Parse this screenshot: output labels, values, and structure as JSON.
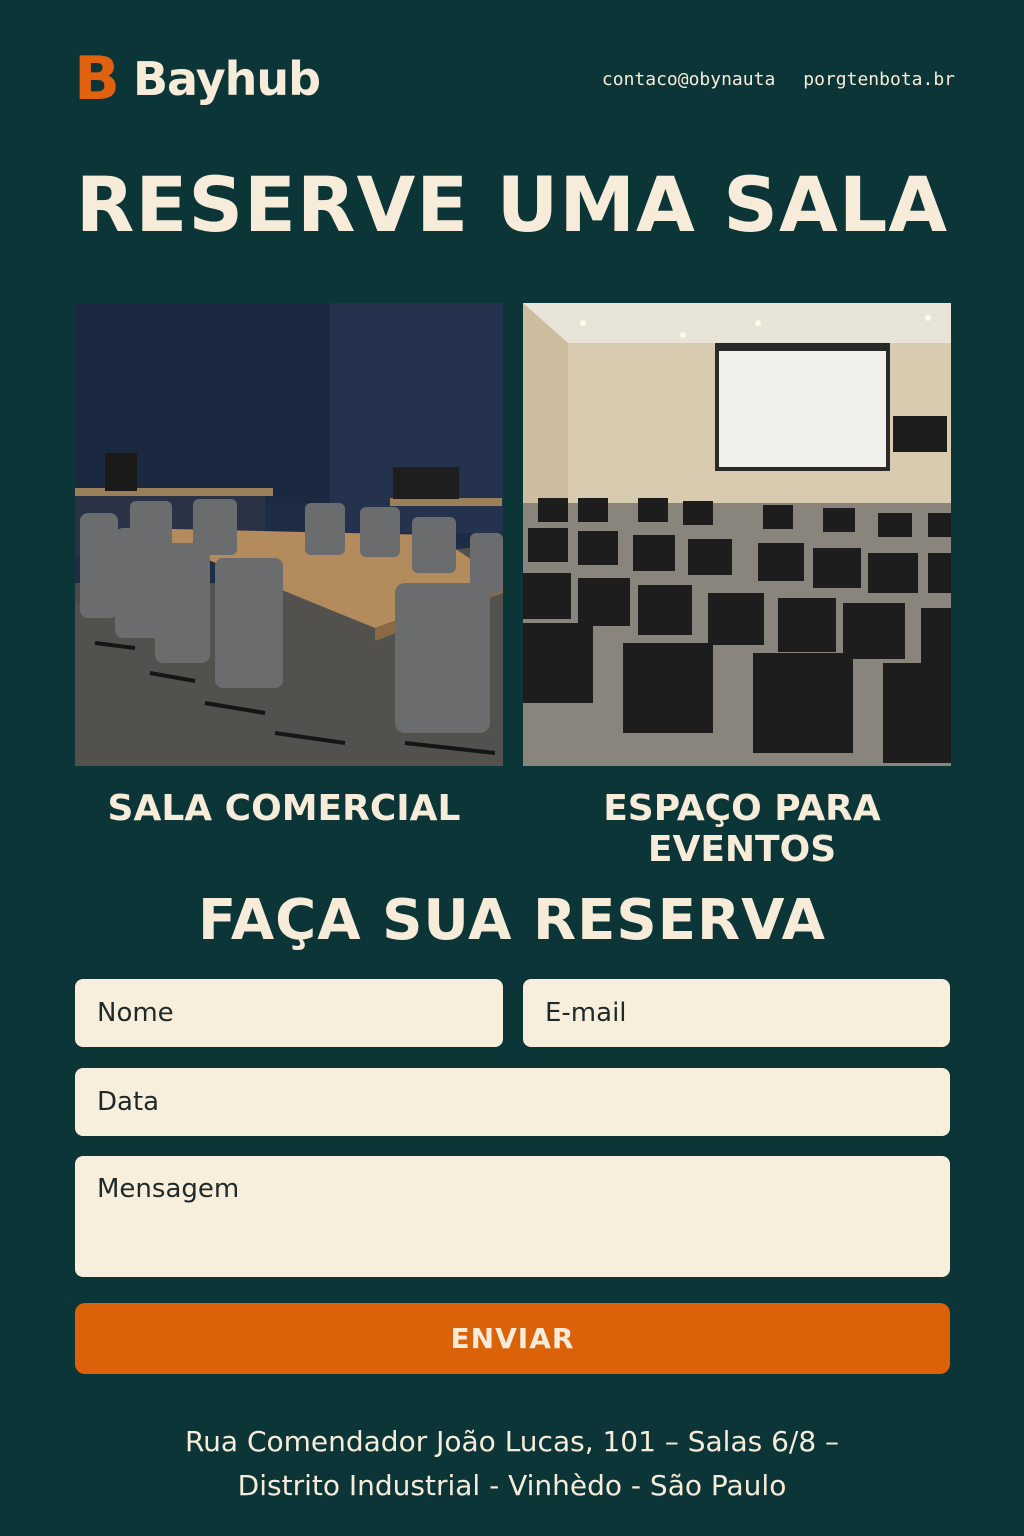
{
  "brand": {
    "logo_letter": "B",
    "name": "Bayhub",
    "accent_color": "#e0620f"
  },
  "header": {
    "contacts": [
      "contaco@obynauta",
      "porgtenbota.br"
    ]
  },
  "hero": {
    "title": "RESERVE UMA SALA"
  },
  "rooms": [
    {
      "label": "SALA COMERCIAL",
      "image": "conference-room-photo"
    },
    {
      "label": "ESPAÇO PARA EVENTOS",
      "image": "event-hall-photo"
    }
  ],
  "form": {
    "title": "FAÇA SUA RESERVA",
    "name_placeholder": "Nome",
    "email_placeholder": "E-mail",
    "date_placeholder": "Data",
    "message_placeholder": "Mensagem",
    "submit_label": "ENVIAR"
  },
  "footer": {
    "address_line1": "Rua Comendador João Lucas, 101 – Salas 6/8 –",
    "address_line2": "Distrito Industrial - Vinhèdo - São Paulo"
  },
  "colors": {
    "background": "#0c3537",
    "text": "#f6ecd9",
    "field_bg": "#f7efdc",
    "button": "#db6209"
  }
}
